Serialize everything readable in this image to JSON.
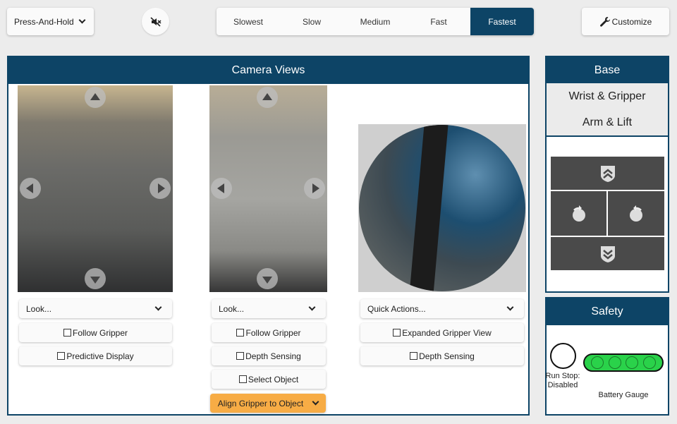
{
  "topbar": {
    "action_mode": "Press-And-Hold",
    "speeds": [
      "Slowest",
      "Slow",
      "Medium",
      "Fast",
      "Fastest"
    ],
    "active_speed": "Fastest",
    "customize_label": "Customize"
  },
  "camera_panel": {
    "title": "Camera Views",
    "overhead": {
      "select_label": "Look...",
      "checkboxes": [
        "Follow Gripper",
        "Predictive Display"
      ]
    },
    "realsense": {
      "select_label": "Look...",
      "checkboxes": [
        "Follow Gripper",
        "Depth Sensing",
        "Select Object"
      ],
      "action_label": "Align Gripper to Object"
    },
    "gripper": {
      "select_label": "Quick Actions...",
      "checkboxes": [
        "Expanded Gripper View",
        "Depth Sensing"
      ]
    }
  },
  "base_panel": {
    "tabs": [
      "Base",
      "Wrist & Gripper",
      "Arm & Lift"
    ],
    "active_tab": "Base"
  },
  "safety_panel": {
    "title": "Safety",
    "runstop_label": "Run Stop: Disabled",
    "battery_label": "Battery Gauge"
  },
  "colors": {
    "primary": "#0d4466",
    "accent_orange": "#f7ac45",
    "battery_green": "#2ad24a"
  }
}
